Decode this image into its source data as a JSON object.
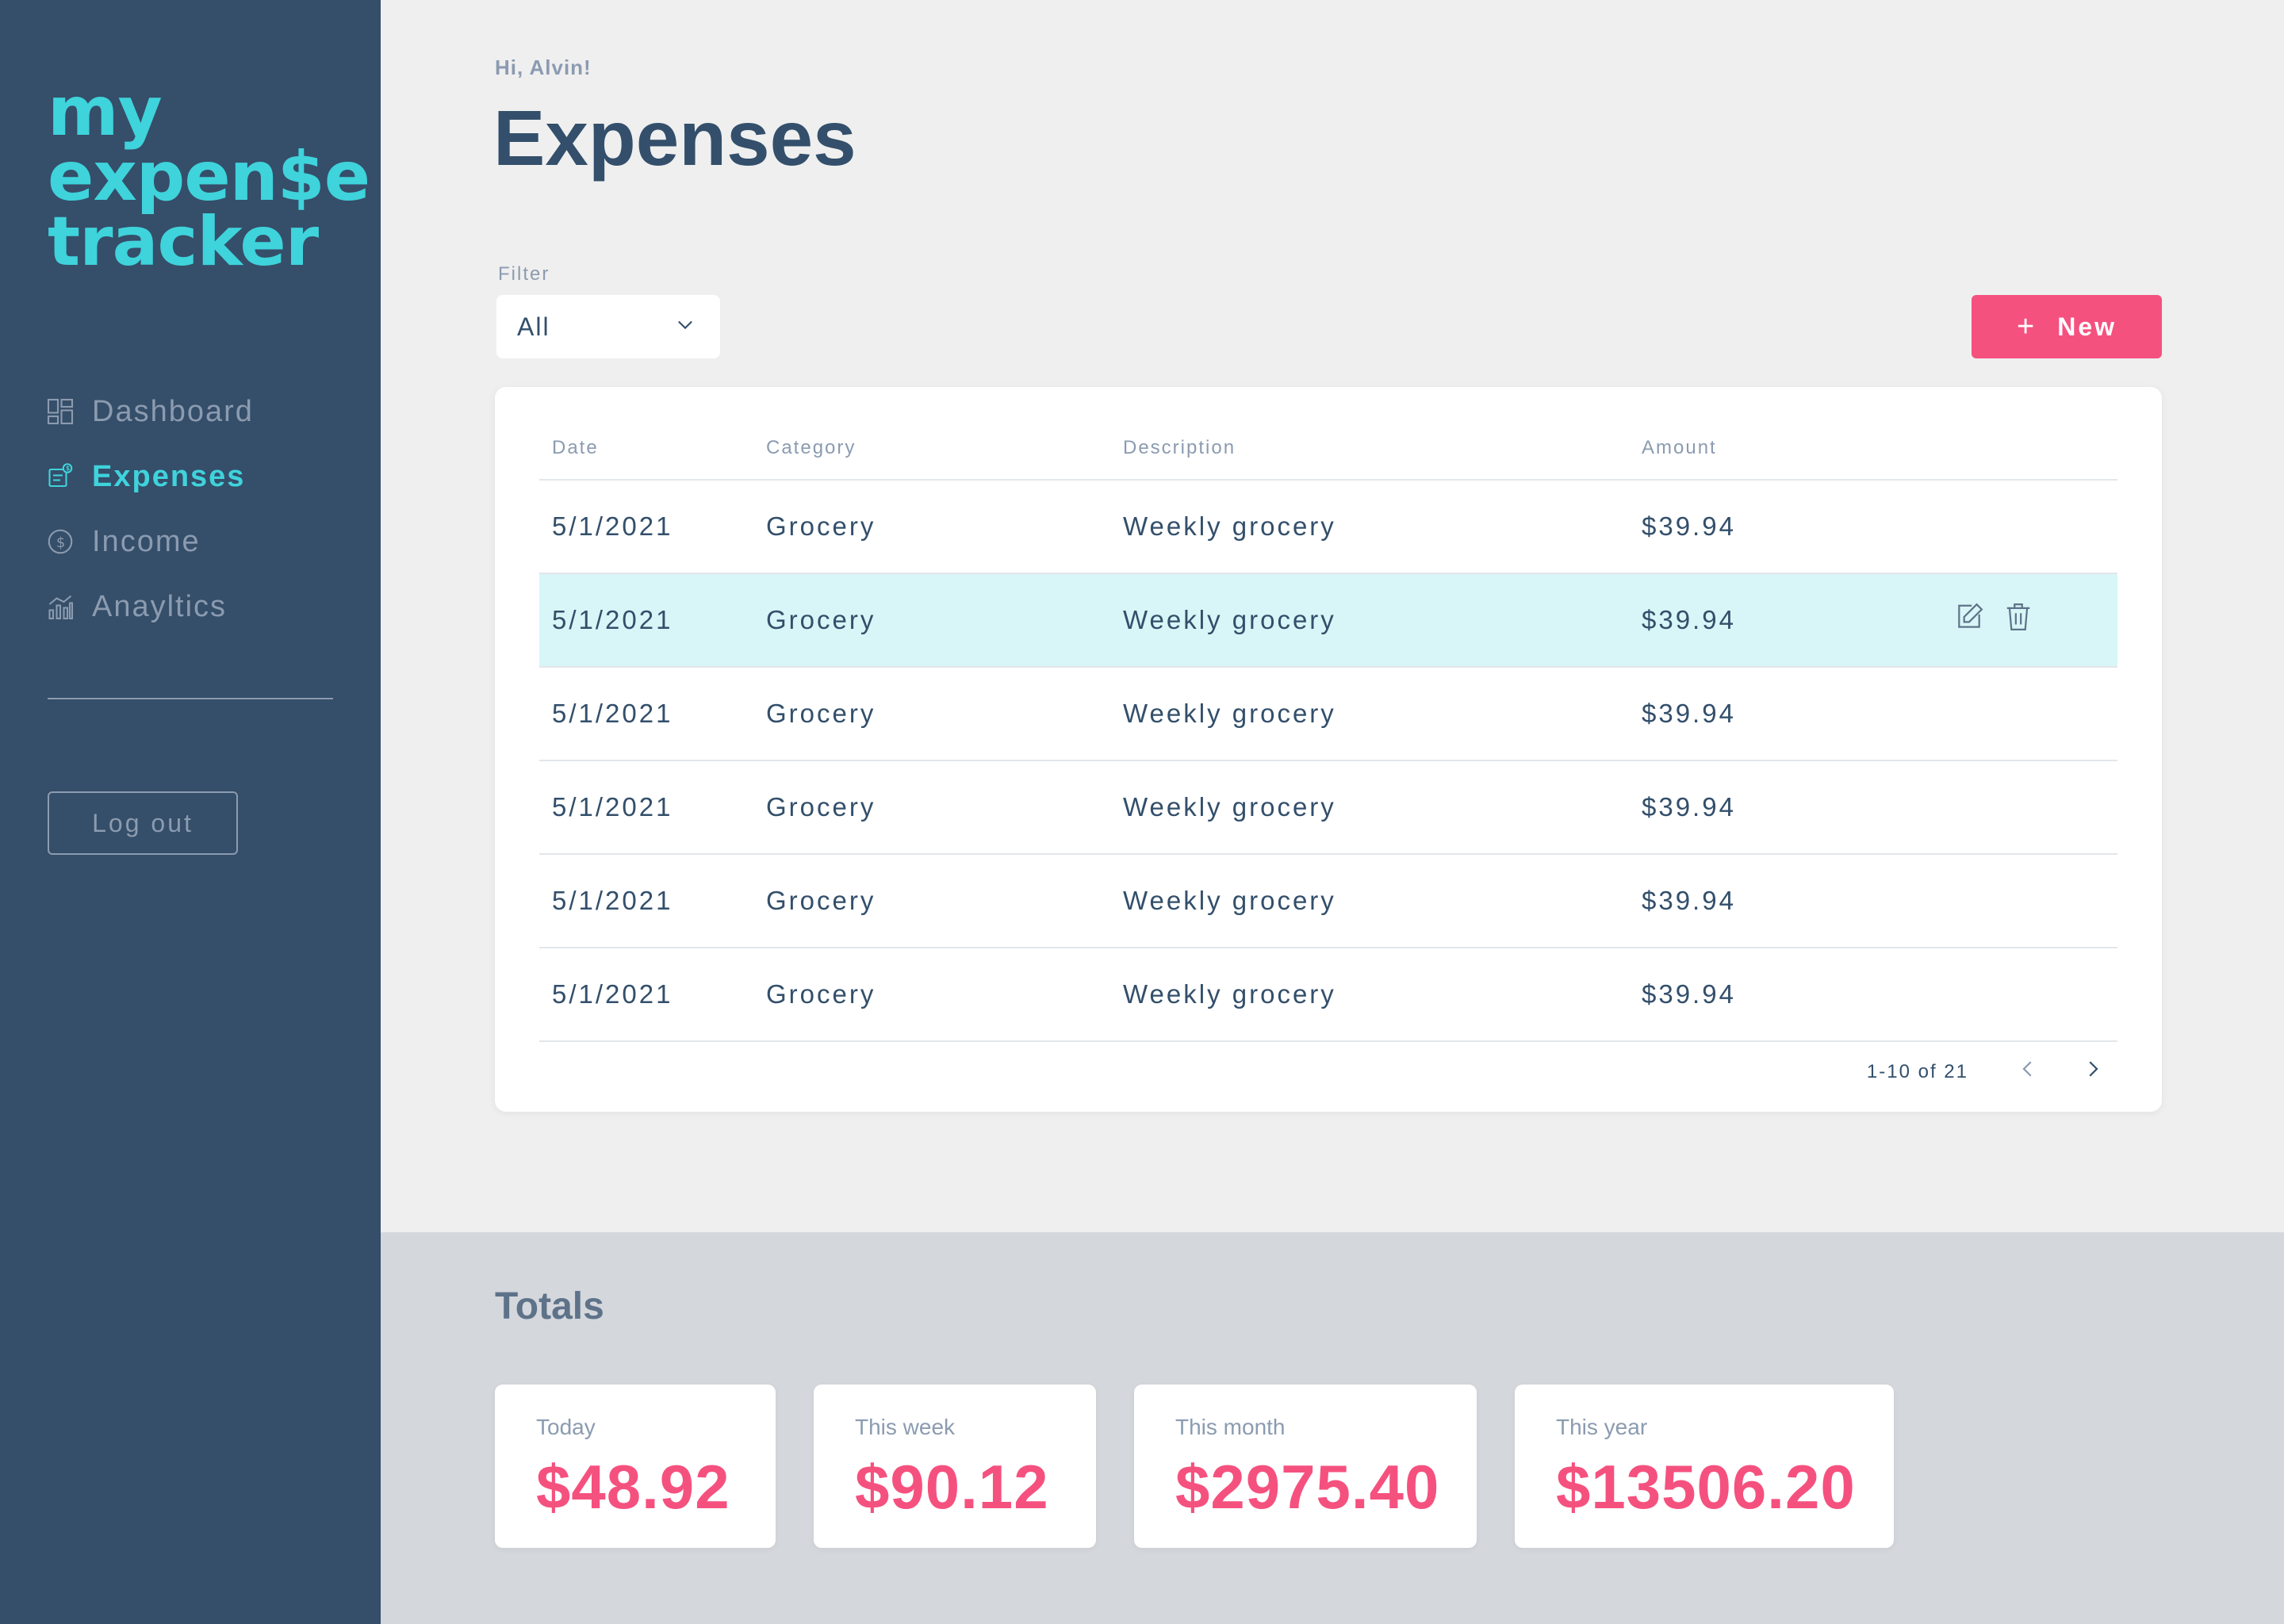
{
  "brand": {
    "line1": "my",
    "line2": "expen$e",
    "line3": "tracker"
  },
  "nav": {
    "items": [
      {
        "label": "Dashboard",
        "icon": "dashboard-icon"
      },
      {
        "label": "Expenses",
        "icon": "expenses-icon",
        "active": true
      },
      {
        "label": "Income",
        "icon": "dollar-circle-icon"
      },
      {
        "label": "Anayltics",
        "icon": "analytics-chart-icon"
      }
    ]
  },
  "logout_label": "Log out",
  "header": {
    "greeting": "Hi, Alvin!",
    "title": "Expenses"
  },
  "filter": {
    "label": "Filter",
    "value": "All"
  },
  "new_button": {
    "plus": "+",
    "label": "New"
  },
  "table": {
    "headers": {
      "date": "Date",
      "category": "Category",
      "description": "Description",
      "amount": "Amount"
    },
    "rows": [
      {
        "date": "5/1/2021",
        "category": "Grocery",
        "description": "Weekly grocery",
        "amount": "$39.94"
      },
      {
        "date": "5/1/2021",
        "category": "Grocery",
        "description": "Weekly grocery",
        "amount": "$39.94"
      },
      {
        "date": "5/1/2021",
        "category": "Grocery",
        "description": "Weekly grocery",
        "amount": "$39.94"
      },
      {
        "date": "5/1/2021",
        "category": "Grocery",
        "description": "Weekly grocery",
        "amount": "$39.94"
      },
      {
        "date": "5/1/2021",
        "category": "Grocery",
        "description": "Weekly grocery",
        "amount": "$39.94"
      },
      {
        "date": "5/1/2021",
        "category": "Grocery",
        "description": "Weekly grocery",
        "amount": "$39.94"
      }
    ],
    "pagination": {
      "range": "1-10 of 21"
    }
  },
  "totals": {
    "title": "Totals",
    "cards": [
      {
        "label": "Today",
        "value": "$48.92"
      },
      {
        "label": "This week",
        "value": "$90.12"
      },
      {
        "label": "This month",
        "value": "$2975.40"
      },
      {
        "label": "This year",
        "value": "$13506.20"
      }
    ]
  },
  "colors": {
    "sidebar": "#354e69",
    "accent_cyan": "#3fd3dc",
    "accent_pink": "#f5517f",
    "text_dark": "#334f6b",
    "text_muted": "#8b9bb0",
    "row_hover": "#d8f6f7"
  }
}
